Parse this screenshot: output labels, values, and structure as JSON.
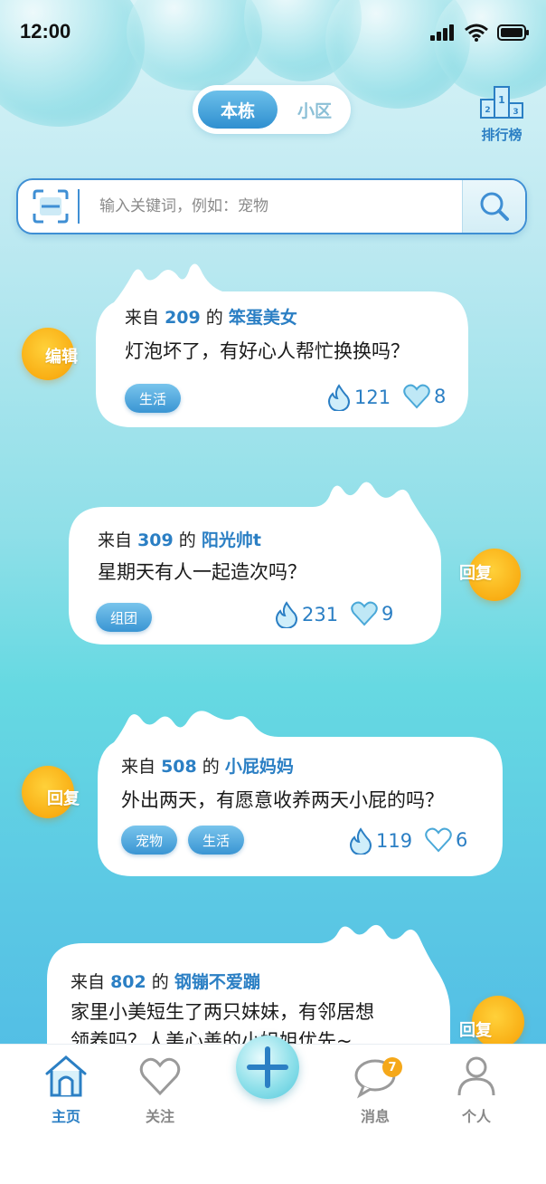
{
  "status_bar": {
    "time": "12:00"
  },
  "scope_toggle": {
    "active": "本栋",
    "other": "小区"
  },
  "ranking": {
    "label": "排行榜"
  },
  "search": {
    "placeholder": "输入关键词，例如：宠物"
  },
  "posts": [
    {
      "from": "来自",
      "building": "209",
      "of": "的",
      "author": "笨蛋美女",
      "content": "灯泡坏了，有好心人帮忙换换吗？",
      "tags": [
        "生活"
      ],
      "hot": "121",
      "likes": "8",
      "action": "编辑"
    },
    {
      "from": "来自",
      "building": "309",
      "of": "的",
      "author": "阳光帅t",
      "content": "星期天有人一起造次吗？",
      "tags": [
        "组团"
      ],
      "hot": "231",
      "likes": "9",
      "action": "回复"
    },
    {
      "from": "来自",
      "building": "508",
      "of": "的",
      "author": "小屁妈妈",
      "content": "外出两天，有愿意收养两天小屁的吗？",
      "tags": [
        "宠物",
        "生活"
      ],
      "hot": "119",
      "likes": "6",
      "action": "回复"
    },
    {
      "from": "来自",
      "building": "802",
      "of": "的",
      "author": "钢镚不爱蹦",
      "content_line1": "家里小美短生了两只妹妹，有邻居想",
      "content_line2": "领养吗？人美心善的小姐姐优先~",
      "action": "回复"
    }
  ],
  "tabbar": {
    "home": "主页",
    "follow": "关注",
    "messages": "消息",
    "messages_badge": "7",
    "profile": "个人"
  },
  "colors": {
    "accent": "#2b7fc4",
    "orb": "#f9ae14",
    "tag": "#3a95d3"
  }
}
